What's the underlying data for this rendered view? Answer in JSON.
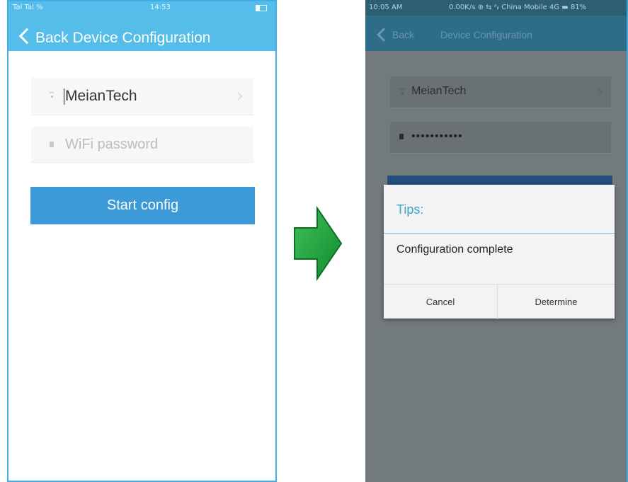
{
  "left_screen": {
    "status": {
      "signal": "Tal Tal %",
      "time": "14:53"
    },
    "header": {
      "back_label": "Back",
      "title": "Device Configuration"
    },
    "wifi_field": {
      "value": "MeianTech",
      "icon": "wifi-icon"
    },
    "password_field": {
      "placeholder": "WiFi password",
      "icon": "lock-icon"
    },
    "start_button": {
      "label": "Start config"
    },
    "colors": {
      "header": "#55bde9",
      "button": "#3c9ad9"
    }
  },
  "arrow": {
    "icon": "right-arrow-icon",
    "color": "#1e9a3a"
  },
  "right_screen": {
    "status": {
      "left": "10:05 AM",
      "right": "0.00K/s ⊕ ⇆ ᵃᵢₗ China Mobile 4G ▬ 81%"
    },
    "header": {
      "back_label": "Back",
      "title": "Device Configuration"
    },
    "wifi_field": {
      "value": "MeianTech",
      "icon": "wifi-icon"
    },
    "password_field": {
      "value": "•••••••••••",
      "icon": "lock-icon"
    },
    "dialog": {
      "title": "Tips:",
      "message": "Configuration complete",
      "cancel_label": "Cancel",
      "confirm_label": "Determine"
    },
    "colors": {
      "overlay": "#737a7d",
      "dialog_title": "#3aa6ce"
    }
  }
}
